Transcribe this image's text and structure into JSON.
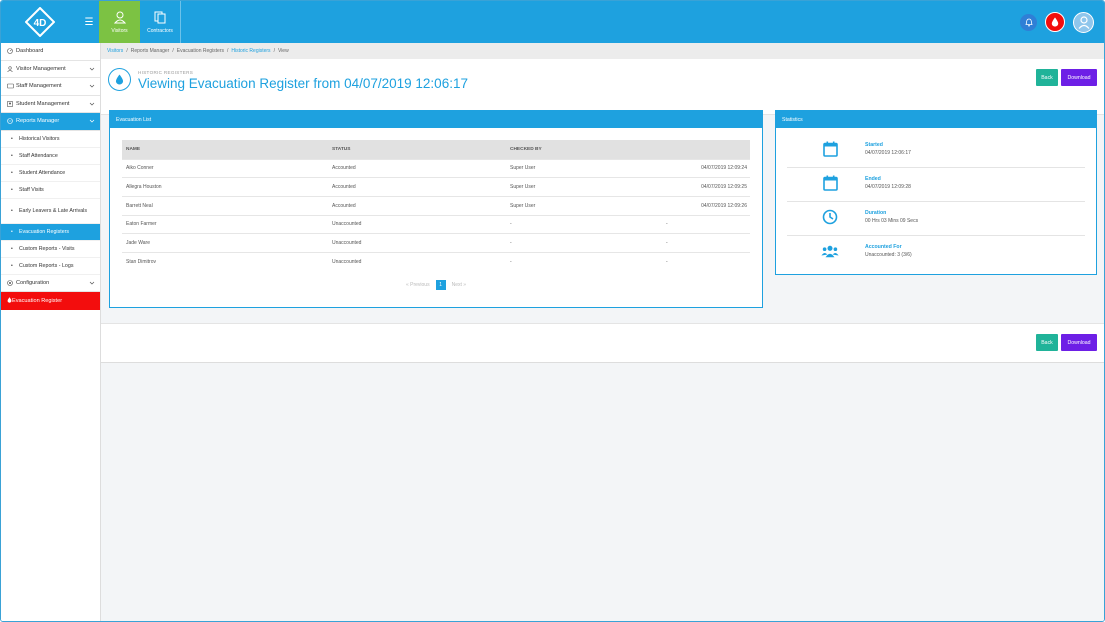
{
  "app": {
    "logo_text": "4D",
    "tabs": [
      {
        "label": "Visitors"
      },
      {
        "label": "Contractors"
      }
    ]
  },
  "sidebar": {
    "items": [
      {
        "label": "Dashboard"
      },
      {
        "label": "Visitor Management"
      },
      {
        "label": "Staff Management"
      },
      {
        "label": "Student Management"
      },
      {
        "label": "Reports Manager"
      }
    ],
    "sub_items": [
      {
        "label": "Historical Visitors"
      },
      {
        "label": "Staff Attendance"
      },
      {
        "label": "Student Attendance"
      },
      {
        "label": "Staff Visits"
      },
      {
        "label": "Early Leavers & Late Arrivals"
      },
      {
        "label": "Evacuation Registers"
      },
      {
        "label": "Custom Reports - Visits"
      },
      {
        "label": "Custom Reports - Logs"
      }
    ],
    "configuration": "Configuration",
    "evacuation_register": "Evacuation Register"
  },
  "breadcrumb": [
    "Visitors",
    "Reports Manager",
    "Evacuation Registers",
    "Historic Registers",
    "View"
  ],
  "header": {
    "subtitle": "HISTORIC REGISTERS",
    "title": "Viewing Evacuation Register from 04/07/2019 12:06:17",
    "back_label": "Back",
    "download_label": "Download"
  },
  "evacuation_list": {
    "heading": "Evacuation List",
    "columns": [
      "NAME",
      "STATUS",
      "CHECKED BY",
      ""
    ],
    "rows": [
      [
        "Aiko Conner",
        "Accounted",
        "Super User",
        "04/07/2019 12:09:24"
      ],
      [
        "Allegra Houston",
        "Accounted",
        "Super User",
        "04/07/2019 12:09:25"
      ],
      [
        "Barrett Neal",
        "Accounted",
        "Super User",
        "04/07/2019 12:09:26"
      ],
      [
        "Eaton Farmer",
        "Unaccounted",
        "-",
        "-"
      ],
      [
        "Jade Ware",
        "Unaccounted",
        "-",
        "-"
      ],
      [
        "Stan Dimitrov",
        "Unaccounted",
        "-",
        "-"
      ]
    ],
    "pager": {
      "previous": "Previous",
      "page": "1",
      "next": "Next"
    }
  },
  "statistics": {
    "heading": "Statistics",
    "items": [
      {
        "label": "Started",
        "value": "04/07/2019 12:06:17",
        "icon": "calendar-icon"
      },
      {
        "label": "Ended",
        "value": "04/07/2019 12:09:28",
        "icon": "calendar-icon"
      },
      {
        "label": "Duration",
        "value": "00 Hrs 03 Mins 09 Secs",
        "icon": "clock-icon"
      },
      {
        "label": "Accounted For",
        "value": "Unaccounted: 3 (3/6)",
        "icon": "users-icon"
      }
    ]
  },
  "footer": {
    "back_label": "Back",
    "download_label": "Download"
  },
  "colors": {
    "primary": "#1ea1df",
    "active_tab": "#7cc243",
    "danger": "#f30d0d",
    "back": "#20b399",
    "download": "#6d1fe6"
  }
}
